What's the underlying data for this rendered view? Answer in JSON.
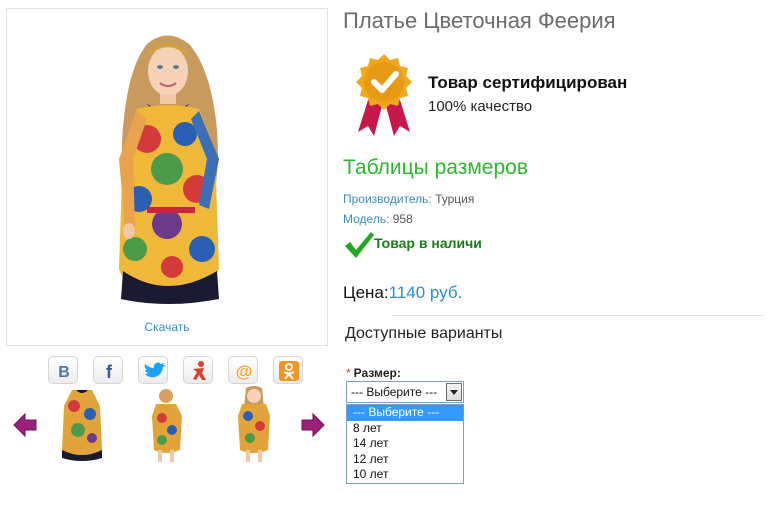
{
  "product": {
    "title": "Платье Цветочная Феерия",
    "download_label": "Скачать"
  },
  "share": {
    "buttons": [
      {
        "icon": "vk-icon",
        "color": "#4a76a8"
      },
      {
        "icon": "facebook-icon",
        "color": "#3b5998"
      },
      {
        "icon": "twitter-icon",
        "color": "#1da1f2"
      },
      {
        "icon": "moimir-icon",
        "color": "#e03c2a"
      },
      {
        "icon": "mailru-icon",
        "color": "#f5a623"
      },
      {
        "icon": "odnoklassniki-icon",
        "color": "#f7931e"
      }
    ]
  },
  "certification": {
    "title": "Товар сертифицирован",
    "subtitle": "100% качество"
  },
  "info": {
    "size_table_label": "Таблицы размеров",
    "manufacturer_key": "Производитель:",
    "manufacturer_value": "Турция",
    "model_key": "Модель:",
    "model_value": "958",
    "stock_text": "Товар в наличи"
  },
  "price": {
    "label": "Цена:",
    "amount": "1140 руб."
  },
  "variants": {
    "heading": "Доступные варианты",
    "required_mark": "*",
    "size_label": "Размер:",
    "selected": "--- Выберите ---",
    "options": [
      "--- Выберите ---",
      "8 лет",
      "14 лет",
      "12 лет",
      "10 лет"
    ]
  },
  "colors": {
    "accent_green": "#2eb82e",
    "link_blue": "#3b8dbd",
    "price_blue": "#2a8fd0",
    "stock_green": "#1f7a1f",
    "arrow_purple": "#9b1f7d",
    "badge_gold": "#f2a81d",
    "badge_ribbon": "#c8174a"
  }
}
